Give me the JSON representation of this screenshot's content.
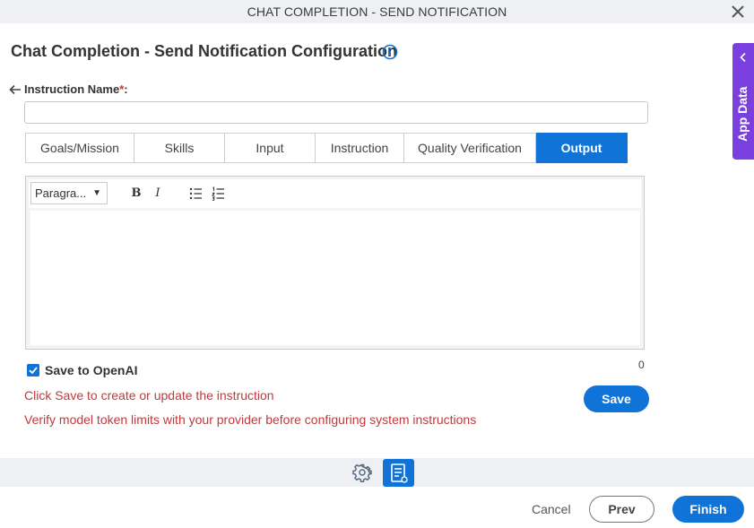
{
  "window": {
    "title": "CHAT COMPLETION - SEND NOTIFICATION"
  },
  "header": {
    "title": "Chat Completion - Send Notification Configuration"
  },
  "instruction_name": {
    "label": "Instruction Name",
    "required_mark": "*",
    "colon": ":",
    "value": "",
    "placeholder": ""
  },
  "tabs": [
    {
      "label": "Goals/Mission",
      "active": false
    },
    {
      "label": "Skills",
      "active": false
    },
    {
      "label": "Input",
      "active": false
    },
    {
      "label": "Instruction",
      "active": false
    },
    {
      "label": "Quality Verification",
      "active": false
    },
    {
      "label": "Output",
      "active": true
    }
  ],
  "editor": {
    "paragraph_select": "Paragra...",
    "bold_label": "B",
    "italic_label": "I",
    "content": ""
  },
  "save_to_openai": {
    "label": "Save to OpenAI",
    "checked": true
  },
  "char_count": "0",
  "messages": {
    "save_hint": "Click Save to create or update the instruction",
    "token_warning": "Verify model token limits with your provider before configuring system instructions"
  },
  "buttons": {
    "save": "Save",
    "cancel": "Cancel",
    "prev": "Prev",
    "finish": "Finish"
  },
  "app_data_panel": {
    "label": "App Data"
  },
  "colors": {
    "primary": "#0f73d8",
    "app_data": "#7b3fe0",
    "error_text": "#c0393b"
  }
}
